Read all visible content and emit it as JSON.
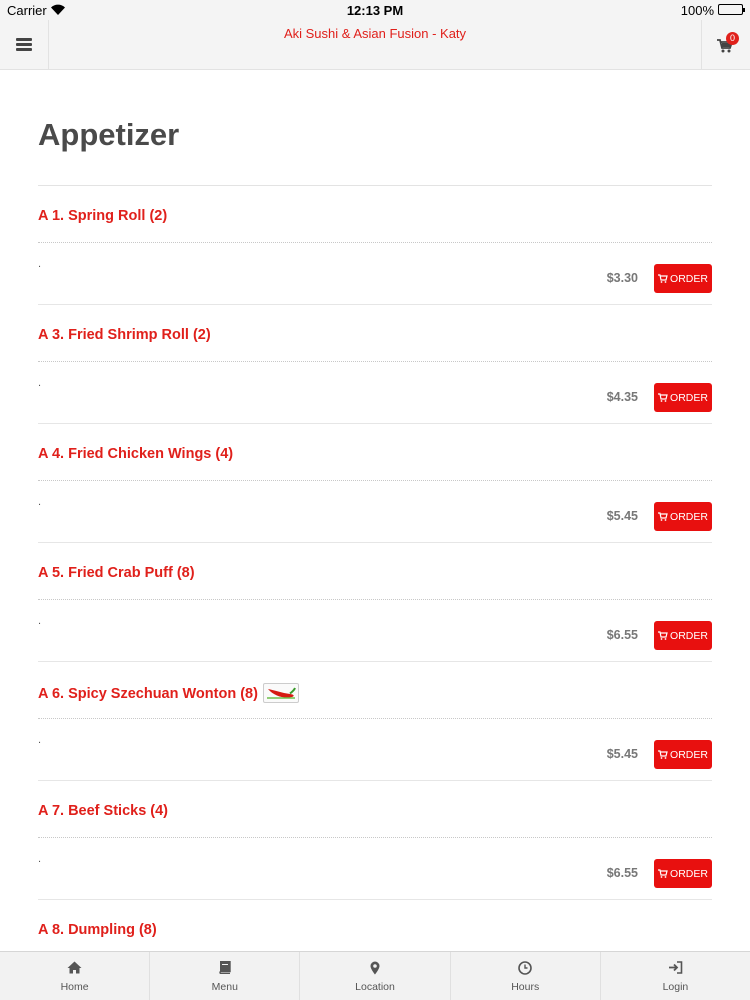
{
  "status_bar": {
    "carrier": "Carrier",
    "time": "12:13 PM",
    "battery": "100%"
  },
  "header": {
    "title": "Aki Sushi & Asian Fusion - Katy",
    "cart_count": "0",
    "accent_color": "#e0201b"
  },
  "section": {
    "title": "Appetizer"
  },
  "items": [
    {
      "name": "A 1. Spring Roll (2)",
      "description": ".",
      "price": "$3.30",
      "order_label": "ORDER",
      "spicy": false
    },
    {
      "name": "A 3. Fried Shrimp Roll (2)",
      "description": ".",
      "price": "$4.35",
      "order_label": "ORDER",
      "spicy": false
    },
    {
      "name": "A 4. Fried Chicken Wings (4)",
      "description": ".",
      "price": "$5.45",
      "order_label": "ORDER",
      "spicy": false
    },
    {
      "name": "A 5. Fried Crab Puff (8)",
      "description": ".",
      "price": "$6.55",
      "order_label": "ORDER",
      "spicy": false
    },
    {
      "name": "A 6. Spicy Szechuan Wonton (8)",
      "description": ".",
      "price": "$5.45",
      "order_label": "ORDER",
      "spicy": true
    },
    {
      "name": "A 7. Beef Sticks (4)",
      "description": ".",
      "price": "$6.55",
      "order_label": "ORDER",
      "spicy": false
    },
    {
      "name": "A 8. Dumpling (8)",
      "description": "",
      "price": "",
      "order_label": "",
      "spicy": false
    }
  ],
  "tabs": [
    {
      "label": "Home",
      "icon": "home-icon"
    },
    {
      "label": "Menu",
      "icon": "book-icon"
    },
    {
      "label": "Location",
      "icon": "map-marker-icon"
    },
    {
      "label": "Hours",
      "icon": "clock-icon"
    },
    {
      "label": "Login",
      "icon": "sign-in-icon"
    }
  ]
}
